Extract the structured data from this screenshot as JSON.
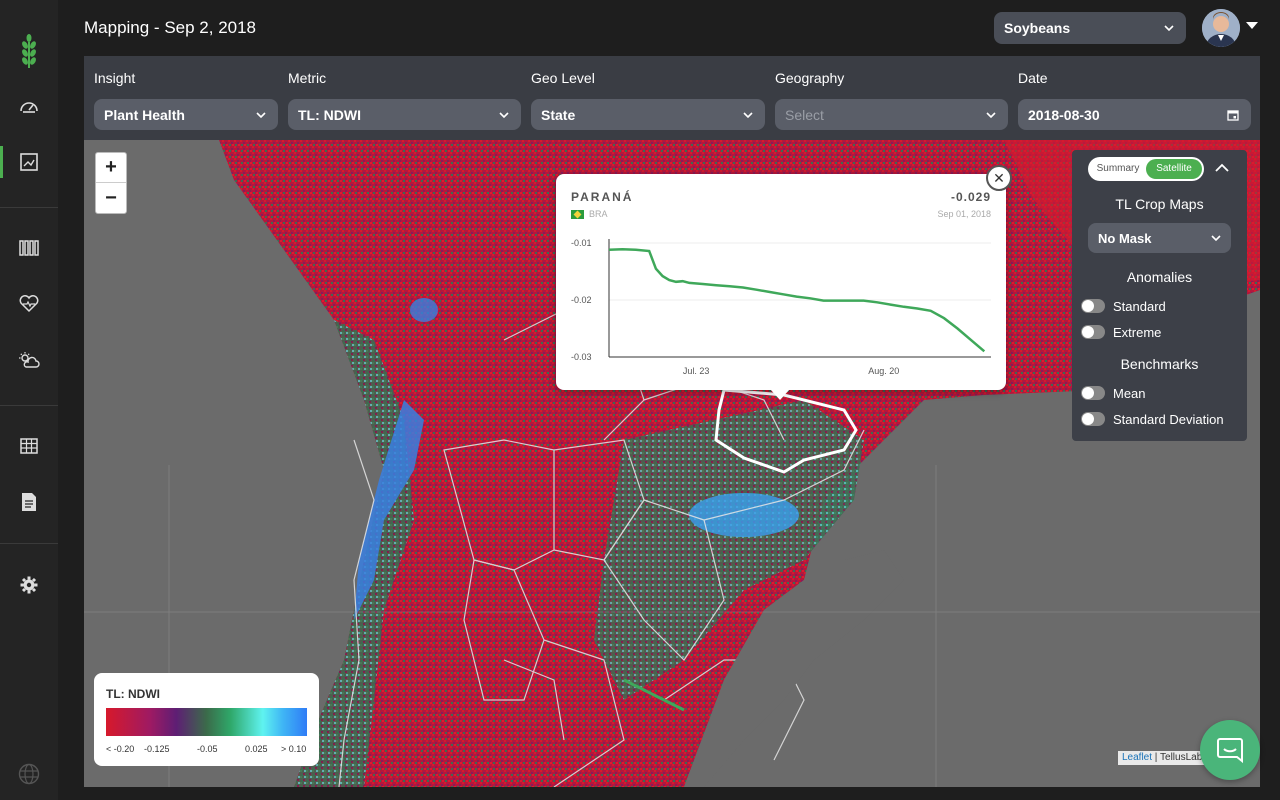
{
  "header": {
    "title": "Mapping - Sep 2, 2018",
    "crop": "Soybeans"
  },
  "filters": [
    {
      "label": "Insight",
      "value": "Plant Health",
      "placeholder": false
    },
    {
      "label": "Metric",
      "value": "TL: NDWI",
      "placeholder": false
    },
    {
      "label": "Geo Level",
      "value": "State",
      "placeholder": false
    },
    {
      "label": "Geography",
      "value": "Select",
      "placeholder": true
    },
    {
      "label": "Date",
      "value": "2018-08-30",
      "placeholder": false
    }
  ],
  "sidebar": {
    "items": [
      {
        "icon": "logo-wheat-icon"
      },
      {
        "icon": "dashboard-gauge-icon"
      },
      {
        "icon": "map-icon",
        "active": true
      },
      {
        "icon": "fields-rows-icon"
      },
      {
        "icon": "health-heart-icon"
      },
      {
        "icon": "weather-icon"
      },
      {
        "icon": "table-icon"
      },
      {
        "icon": "report-document-icon"
      },
      {
        "icon": "settings-gear-icon"
      },
      {
        "icon": "globe-icon"
      }
    ]
  },
  "map": {
    "zoom_in": "+",
    "zoom_out": "−",
    "attribution_link": "Leaflet",
    "attribution_text": " | TellusLabs"
  },
  "popup": {
    "region": "PARANÁ",
    "value": "-0.029",
    "country": "BRA",
    "date": "Sep 01, 2018",
    "close": "✕"
  },
  "chart_data": {
    "type": "line",
    "title": "",
    "xlabel": "",
    "ylabel": "",
    "ylim": [
      -0.03,
      -0.01
    ],
    "yticks": [
      -0.01,
      -0.02,
      -0.03
    ],
    "ytick_labels": [
      "-0.01",
      "-0.02",
      "-0.03"
    ],
    "xtick_labels": [
      {
        "label": "Jul. 23",
        "x": 13
      },
      {
        "label": "Aug. 20",
        "x": 41
      }
    ],
    "xlim": [
      0,
      57
    ],
    "series": [
      {
        "color": "#3fa85a",
        "x": [
          0,
          2,
          4,
          6,
          7,
          8,
          9,
          10,
          11,
          12,
          14,
          16,
          18,
          20,
          22,
          24,
          26,
          28,
          30,
          32,
          34,
          36,
          38,
          40,
          42,
          44,
          46,
          48,
          50,
          52,
          54,
          56
        ],
        "y": [
          -0.0112,
          -0.0111,
          -0.0112,
          -0.0114,
          -0.0145,
          -0.0158,
          -0.0165,
          -0.0168,
          -0.0167,
          -0.017,
          -0.0172,
          -0.0174,
          -0.0176,
          -0.0178,
          -0.0182,
          -0.0186,
          -0.019,
          -0.0194,
          -0.0197,
          -0.0201,
          -0.0201,
          -0.0201,
          -0.0201,
          -0.0204,
          -0.0208,
          -0.0212,
          -0.0215,
          -0.0219,
          -0.0232,
          -0.025,
          -0.027,
          -0.029
        ]
      }
    ]
  },
  "panel": {
    "seg_summary": "Summary",
    "seg_satellite": "Satellite",
    "crop_maps_title": "TL Crop Maps",
    "mask_value": "No Mask",
    "anomalies_title": "Anomalies",
    "anomalies": [
      "Standard",
      "Extreme"
    ],
    "benchmarks_title": "Benchmarks",
    "benchmarks": [
      "Mean",
      "Standard Deviation"
    ]
  },
  "legend": {
    "title": "TL: NDWI",
    "ticks": [
      "< -0.20",
      "-0.125",
      "-0.05",
      "0.025",
      "> 0.10"
    ]
  },
  "colors": {
    "accent": "#4caf50",
    "map_red": "#d7192b",
    "map_green": "#2fa86a",
    "map_cyan": "#5ff3f0"
  }
}
